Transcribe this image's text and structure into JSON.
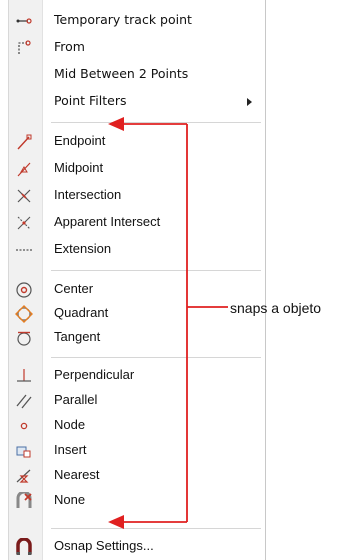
{
  "menu": {
    "items": [
      {
        "label": "Temporary track point",
        "icon": "temporary-track-point-icon"
      },
      {
        "label": "From",
        "icon": "from-icon"
      },
      {
        "label": "Mid Between 2 Points",
        "icon": ""
      },
      {
        "label": "Point Filters",
        "icon": "",
        "submenu_indicator": "submenu-arrow-icon"
      },
      {
        "label": "Endpoint",
        "icon": "endpoint-icon"
      },
      {
        "label": "Midpoint",
        "icon": "midpoint-icon"
      },
      {
        "label": "Intersection",
        "icon": "intersection-icon"
      },
      {
        "label": "Apparent Intersect",
        "icon": "apparent-intersect-icon"
      },
      {
        "label": "Extension",
        "icon": "extension-icon"
      },
      {
        "label": "Center",
        "icon": "center-icon"
      },
      {
        "label": "Quadrant",
        "icon": "quadrant-icon"
      },
      {
        "label": "Tangent",
        "icon": "tangent-icon"
      },
      {
        "label": "Perpendicular",
        "icon": "perpendicular-icon"
      },
      {
        "label": "Parallel",
        "icon": "parallel-icon"
      },
      {
        "label": "Node",
        "icon": "node-icon"
      },
      {
        "label": "Insert",
        "icon": "insert-icon"
      },
      {
        "label": "Nearest",
        "icon": "nearest-icon"
      },
      {
        "label": "None",
        "icon": "none-icon"
      },
      {
        "label": "Osnap Settings...",
        "icon": "osnap-settings-icon"
      }
    ]
  },
  "annotation": {
    "text": "snaps a objeto",
    "color": "#e02020"
  }
}
